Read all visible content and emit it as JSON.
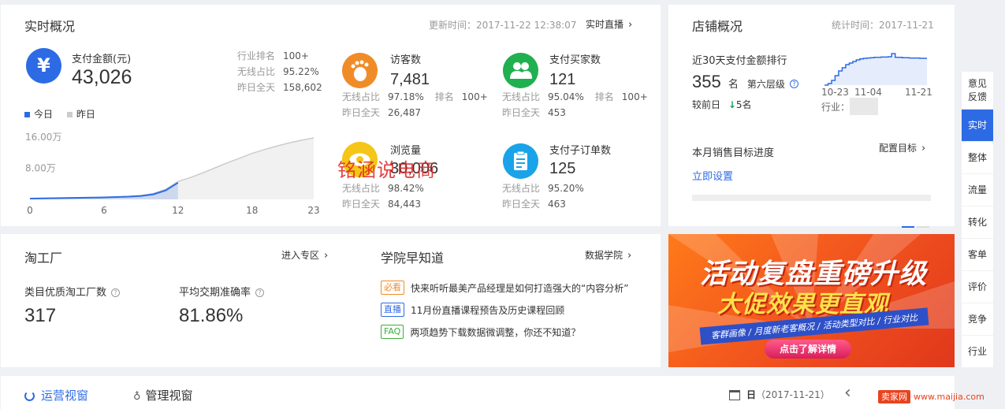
{
  "realtime": {
    "title": "实时概况",
    "update_time": "更新时间：2017-11-22 12:38:07",
    "live_link": "实时直播",
    "legend_today": "今日",
    "legend_yesterday": "昨日",
    "payment": {
      "label": "支付金额(元)",
      "value": "43,026",
      "rows": [
        {
          "k": "行业排名",
          "v": "100+"
        },
        {
          "k": "无线占比",
          "v": "95.22%"
        },
        {
          "k": "昨日全天",
          "v": "158,602"
        }
      ]
    },
    "metrics": [
      {
        "label": "访客数",
        "value": "7,481",
        "rows": [
          {
            "k": "无线占比",
            "v": "97.18%",
            "k2": "排名",
            "v2": "100+"
          },
          {
            "k": "昨日全天",
            "v": "26,487"
          }
        ]
      },
      {
        "label": "支付买家数",
        "value": "121",
        "rows": [
          {
            "k": "无线占比",
            "v": "95.04%",
            "k2": "排名",
            "v2": "100+"
          },
          {
            "k": "昨日全天",
            "v": "453"
          }
        ]
      },
      {
        "label": "浏览量",
        "value": "30,006",
        "rows": [
          {
            "k": "无线占比",
            "v": "98.42%"
          },
          {
            "k": "昨日全天",
            "v": "84,443"
          }
        ]
      },
      {
        "label": "支付子订单数",
        "value": "125",
        "rows": [
          {
            "k": "无线占比",
            "v": "95.20%"
          },
          {
            "k": "昨日全天",
            "v": "463"
          }
        ]
      }
    ],
    "watermark": "铭涵说电商"
  },
  "chart_data": {
    "type": "area",
    "x": [
      0,
      1,
      2,
      3,
      4,
      5,
      6,
      7,
      8,
      9,
      10,
      11,
      12,
      13,
      14,
      15,
      16,
      17,
      18,
      19,
      20,
      21,
      22,
      23
    ],
    "xticks": [
      "0",
      "6",
      "12",
      "18",
      "23"
    ],
    "yticks": [
      "16.00万",
      "8.00万"
    ],
    "ylim": [
      0,
      16
    ],
    "series": [
      {
        "name": "今日",
        "color": "#2d6be5",
        "values": [
          0.2,
          0.25,
          0.3,
          0.35,
          0.4,
          0.45,
          0.5,
          0.6,
          0.7,
          0.9,
          1.3,
          2.3,
          4.3
        ]
      },
      {
        "name": "昨日",
        "color": "#cccccc",
        "values": [
          0.2,
          0.25,
          0.3,
          0.35,
          0.4,
          0.45,
          0.5,
          0.6,
          0.75,
          1.0,
          1.5,
          2.6,
          4.6,
          5.6,
          6.8,
          8.1,
          9.4,
          10.6,
          11.8,
          12.8,
          13.7,
          14.5,
          15.2,
          15.8
        ]
      }
    ]
  },
  "shop": {
    "title": "店铺概况",
    "stat_time": "统计时间：2017-11-21",
    "rank_title": "近30天支付金额排行",
    "rank_value": "355",
    "rank_unit": "名",
    "tier": "第六层级",
    "compare_label": "较前日",
    "compare_value": "5名",
    "industry_label": "行业：",
    "mini_xticks": [
      "10-23",
      "11-04",
      "11-21"
    ],
    "mini_rank_series": [
      0,
      0.05,
      0.15,
      0.3,
      0.45,
      0.55,
      0.65,
      0.7,
      0.75,
      0.8,
      0.83,
      0.85,
      0.86,
      0.87,
      0.88,
      0.88,
      0.89,
      0.89,
      0.9,
      1.0,
      0.88,
      0.88,
      0.87,
      0.87,
      0.86,
      0.86,
      0.86,
      0.85,
      0.85,
      0.85
    ],
    "target_title": "本月销售目标进度",
    "target_link": "配置目标",
    "set_link": "立即设置"
  },
  "factory": {
    "title": "淘工厂",
    "enter_link": "进入专区",
    "metrics": [
      {
        "label": "类目优质淘工厂数",
        "value": "317"
      },
      {
        "label": "平均交期准确率",
        "value": "81.86%"
      }
    ]
  },
  "academy": {
    "title": "学院早知道",
    "link": "数据学院",
    "news": [
      {
        "tag": "必看",
        "tag_color": "#f08c28",
        "text": "快来听听最美产品经理是如何打造强大的“内容分析”"
      },
      {
        "tag": "直播",
        "tag_color": "#2d6be5",
        "text": "11月份直播课程预告及历史课程回顾"
      },
      {
        "tag": "FAQ",
        "tag_color": "#3cae3c",
        "text": "两项趋势下载数据微调整，你还不知道？"
      }
    ]
  },
  "banner": {
    "line1": "活动复盘重磅升级",
    "line2": "大促效果更直观",
    "tags": "客群画像 / 月度新老客概况 / 活动类型对比 / 行业对比",
    "button": "点击了解详情"
  },
  "sidebar": {
    "items": [
      "意见反馈",
      "实时",
      "整体",
      "流量",
      "转化",
      "客单",
      "评价",
      "竞争",
      "行业"
    ]
  },
  "bottom": {
    "tab1": "运营视窗",
    "tab2": "管理视窗",
    "date_label": "日",
    "date_value": "（2017-11-21）",
    "site_mark": "卖家网",
    "site_url": "www.maijia.com"
  },
  "colors": {
    "accent": "#2d6be5",
    "orange": "#f08c28",
    "green": "#20b050",
    "banner_red": "#e8431e",
    "down_green": "#1aa260"
  }
}
